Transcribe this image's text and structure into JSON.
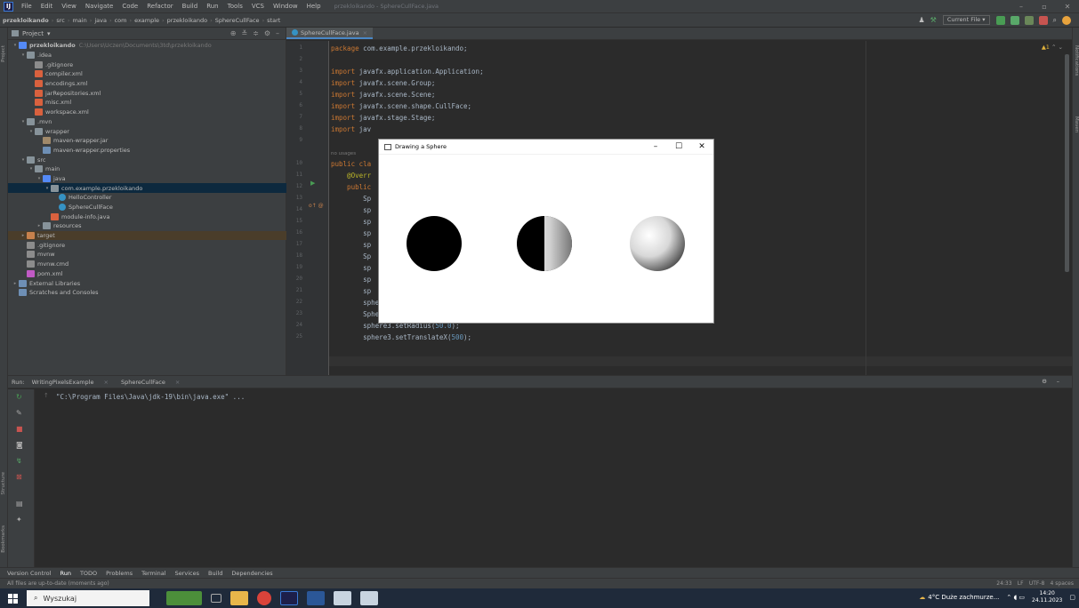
{
  "window": {
    "menu": [
      "File",
      "Edit",
      "View",
      "Navigate",
      "Code",
      "Refactor",
      "Build",
      "Run",
      "Tools",
      "VCS",
      "Window",
      "Help"
    ],
    "title": "przekloikando - SphereCullFace.java"
  },
  "navbar": {
    "crumbs": [
      "przekloikando",
      "src",
      "main",
      "java",
      "com",
      "example",
      "przekloikando",
      "SphereCullFace",
      "start"
    ],
    "run_config": "Current File"
  },
  "project": {
    "header": "Project",
    "tree": [
      {
        "label": "przekloikando",
        "path": "C:\\Users\\Uczen\\Documents\\3td\\przekloikando",
        "icon": "folderb",
        "indent": 0,
        "arrow": "v",
        "bold": true
      },
      {
        "label": ".idea",
        "icon": "folder",
        "indent": 1,
        "arrow": "v"
      },
      {
        "label": ".gitignore",
        "icon": "file",
        "indent": 2
      },
      {
        "label": "compiler.xml",
        "icon": "xml",
        "indent": 2
      },
      {
        "label": "encodings.xml",
        "icon": "xml",
        "indent": 2
      },
      {
        "label": "jarRepositories.xml",
        "icon": "xml",
        "indent": 2
      },
      {
        "label": "misc.xml",
        "icon": "xml",
        "indent": 2
      },
      {
        "label": "workspace.xml",
        "icon": "xml",
        "indent": 2
      },
      {
        "label": ".mvn",
        "icon": "folder",
        "indent": 1,
        "arrow": "v"
      },
      {
        "label": "wrapper",
        "icon": "folder",
        "indent": 2,
        "arrow": "v"
      },
      {
        "label": "maven-wrapper.jar",
        "icon": "jar",
        "indent": 3
      },
      {
        "label": "maven-wrapper.properties",
        "icon": "prop",
        "indent": 3
      },
      {
        "label": "src",
        "icon": "folder",
        "indent": 1,
        "arrow": "v"
      },
      {
        "label": "main",
        "icon": "folder",
        "indent": 2,
        "arrow": "v"
      },
      {
        "label": "java",
        "icon": "folderb",
        "indent": 3,
        "arrow": "v"
      },
      {
        "label": "com.example.przekloikando",
        "icon": "folder",
        "indent": 4,
        "arrow": "v",
        "selected": true
      },
      {
        "label": "HelloController",
        "icon": "java",
        "indent": 5
      },
      {
        "label": "SphereCullFace",
        "icon": "java",
        "indent": 5
      },
      {
        "label": "module-info.java",
        "icon": "xml",
        "indent": 4
      },
      {
        "label": "resources",
        "icon": "folder",
        "indent": 3,
        "arrow": ">"
      },
      {
        "label": "target",
        "icon": "foldero",
        "indent": 1,
        "arrow": ">",
        "target": true
      },
      {
        "label": ".gitignore",
        "icon": "file",
        "indent": 1
      },
      {
        "label": "mvnw",
        "icon": "file",
        "indent": 1
      },
      {
        "label": "mvnw.cmd",
        "icon": "file",
        "indent": 1
      },
      {
        "label": "pom.xml",
        "icon": "pom",
        "indent": 1
      },
      {
        "label": "External Libraries",
        "icon": "libs",
        "indent": 0,
        "arrow": ">"
      },
      {
        "label": "Scratches and Consoles",
        "icon": "libs",
        "indent": 0
      }
    ]
  },
  "editor": {
    "tab": "SphereCullFace.java",
    "warnings": "▲1",
    "lines": [
      {
        "n": "1",
        "code": [
          [
            "kw",
            "package "
          ],
          [
            "",
            "com.example.przekloikando;"
          ]
        ]
      },
      {
        "n": "2",
        "code": []
      },
      {
        "n": "3",
        "code": [
          [
            "kw",
            "import "
          ],
          [
            "",
            "javafx.application.Application;"
          ]
        ]
      },
      {
        "n": "4",
        "code": [
          [
            "kw",
            "import "
          ],
          [
            "",
            "javafx.scene.Group;"
          ]
        ]
      },
      {
        "n": "5",
        "code": [
          [
            "kw",
            "import "
          ],
          [
            "",
            "javafx.scene.Scene;"
          ]
        ]
      },
      {
        "n": "6",
        "code": [
          [
            "kw",
            "import "
          ],
          [
            "",
            "javafx.scene.shape.CullFace;"
          ]
        ]
      },
      {
        "n": "7",
        "code": [
          [
            "kw",
            "import "
          ],
          [
            "",
            "javafx.stage.Stage;"
          ]
        ]
      },
      {
        "n": "8",
        "code": [
          [
            "kw",
            "import "
          ],
          [
            "",
            "jav"
          ]
        ]
      },
      {
        "n": "9",
        "code": []
      },
      {
        "n": "",
        "code": [
          [
            "ghost",
            "no usages"
          ]
        ]
      },
      {
        "n": "10",
        "code": [
          [
            "kw",
            "public "
          ],
          [
            "kw",
            "cla"
          ]
        ]
      },
      {
        "n": "11",
        "code": [
          [
            "an",
            "    @Overr"
          ]
        ]
      },
      {
        "n": "12",
        "code": [
          [
            "kw",
            "    public"
          ]
        ]
      },
      {
        "n": "13",
        "code": [
          [
            "",
            "        Sp"
          ]
        ]
      },
      {
        "n": "14",
        "code": [
          [
            "",
            "        sp"
          ]
        ]
      },
      {
        "n": "15",
        "code": [
          [
            "",
            "        sp"
          ]
        ]
      },
      {
        "n": "16",
        "code": [
          [
            "",
            "        sp"
          ]
        ]
      },
      {
        "n": "17",
        "code": [
          [
            "",
            "        sp"
          ]
        ]
      },
      {
        "n": "18",
        "code": [
          [
            "",
            "        Sp"
          ]
        ]
      },
      {
        "n": "19",
        "code": [
          [
            "",
            "        sp"
          ]
        ]
      },
      {
        "n": "20",
        "code": [
          [
            "",
            "        sp"
          ]
        ]
      },
      {
        "n": "21",
        "code": [
          [
            "",
            "        sp"
          ]
        ]
      },
      {
        "n": "22",
        "code": [
          [
            "",
            "        sphere2.setCullFace(CullFace."
          ],
          [
            "it",
            "BACK"
          ],
          [
            "",
            ");"
          ]
        ]
      },
      {
        "n": "23",
        "code": [
          [
            "",
            "        Sphere sphere3 = "
          ],
          [
            "kw",
            "new "
          ],
          [
            "",
            "Sphere();"
          ]
        ]
      },
      {
        "n": "24",
        "code": [
          [
            "",
            "        sphere3.setRadius("
          ],
          [
            "num",
            "50.0"
          ],
          [
            "",
            ");"
          ]
        ]
      },
      {
        "n": "25",
        "code": [
          [
            "",
            "        sphere3.setTranslateX("
          ],
          [
            "num",
            "500"
          ],
          [
            "",
            ");"
          ]
        ]
      }
    ]
  },
  "app_window": {
    "title": "Drawing a Sphere"
  },
  "run": {
    "label": "Run:",
    "tabs": [
      "WritingPixelsExample",
      "SphereCullFace"
    ],
    "output": "\"C:\\Program Files\\Java\\jdk-19\\bin\\java.exe\" ..."
  },
  "bottom_tabs": [
    "Version Control",
    "Run",
    "TODO",
    "Problems",
    "Terminal",
    "Services",
    "Build",
    "Dependencies"
  ],
  "status": {
    "message": "All files are up-to-date (moments ago)",
    "position": "24:33",
    "line_sep": "LF",
    "encoding": "UTF-8",
    "indent": "4 spaces"
  },
  "taskbar": {
    "search": "Wyszukaj",
    "weather": "4°C  Duże zachmurze...",
    "time": "14:20",
    "date": "24.11.2023"
  }
}
